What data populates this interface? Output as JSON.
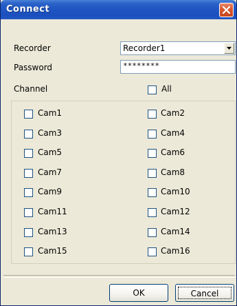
{
  "window": {
    "title": "Connect"
  },
  "form": {
    "recorder_label": "Recorder",
    "recorder_value": "Recorder1",
    "password_label": "Password",
    "password_value": "********",
    "channel_label": "Channel",
    "all_label": "All"
  },
  "channels": [
    {
      "label": "Cam1",
      "checked": false
    },
    {
      "label": "Cam2",
      "checked": false
    },
    {
      "label": "Cam3",
      "checked": false
    },
    {
      "label": "Cam4",
      "checked": false
    },
    {
      "label": "Cam5",
      "checked": false
    },
    {
      "label": "Cam6",
      "checked": false
    },
    {
      "label": "Cam7",
      "checked": false
    },
    {
      "label": "Cam8",
      "checked": false
    },
    {
      "label": "Cam9",
      "checked": false
    },
    {
      "label": "Cam10",
      "checked": false
    },
    {
      "label": "Cam11",
      "checked": false
    },
    {
      "label": "Cam12",
      "checked": false
    },
    {
      "label": "Cam13",
      "checked": false
    },
    {
      "label": "Cam14",
      "checked": false
    },
    {
      "label": "Cam15",
      "checked": false
    },
    {
      "label": "Cam16",
      "checked": false
    }
  ],
  "buttons": {
    "ok": "OK",
    "cancel": "Cancel"
  },
  "icons": {
    "close": "close-icon",
    "dropdown": "chevron-down-icon"
  },
  "colors": {
    "titlebar": "#1f55c2",
    "close": "#d9572f",
    "dialog_bg": "#ece9d8"
  }
}
